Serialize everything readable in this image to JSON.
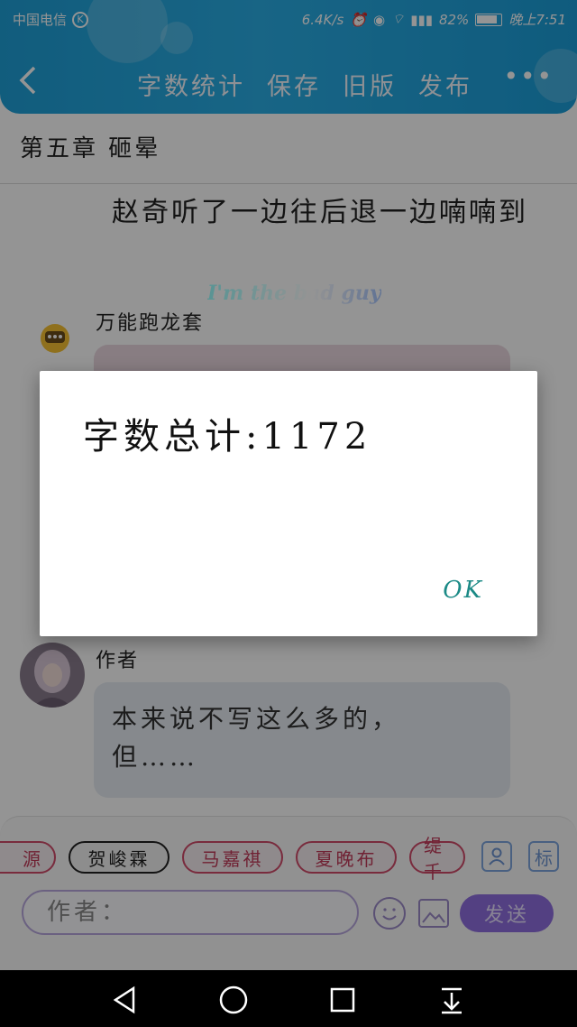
{
  "status_bar": {
    "carrier": "中国电信",
    "carrier_badge": "K",
    "net_speed": "6.4K/s",
    "battery": "82%",
    "time": "晚上7:51"
  },
  "header": {
    "actions": [
      "字数统计",
      "保存",
      "旧版",
      "发布"
    ]
  },
  "chapter": {
    "title": "第五章 砸晕",
    "paragraph": "赵奇听了一边往后退一边喃喃到"
  },
  "tagline": "I'm the bad guy",
  "messages": [
    {
      "name": "万能跑龙套"
    },
    {
      "name": "作者",
      "text": "本来说不写这么多的，但……"
    }
  ],
  "chips": [
    "源",
    "贺峻霖",
    "马嘉祺",
    "夏晚布",
    "缇千"
  ],
  "side_icons": {
    "tag_label": "标"
  },
  "input": {
    "placeholder": "作者："
  },
  "send_label": "发送",
  "dialog": {
    "message": "字数总计:1172",
    "ok_label": "OK"
  }
}
